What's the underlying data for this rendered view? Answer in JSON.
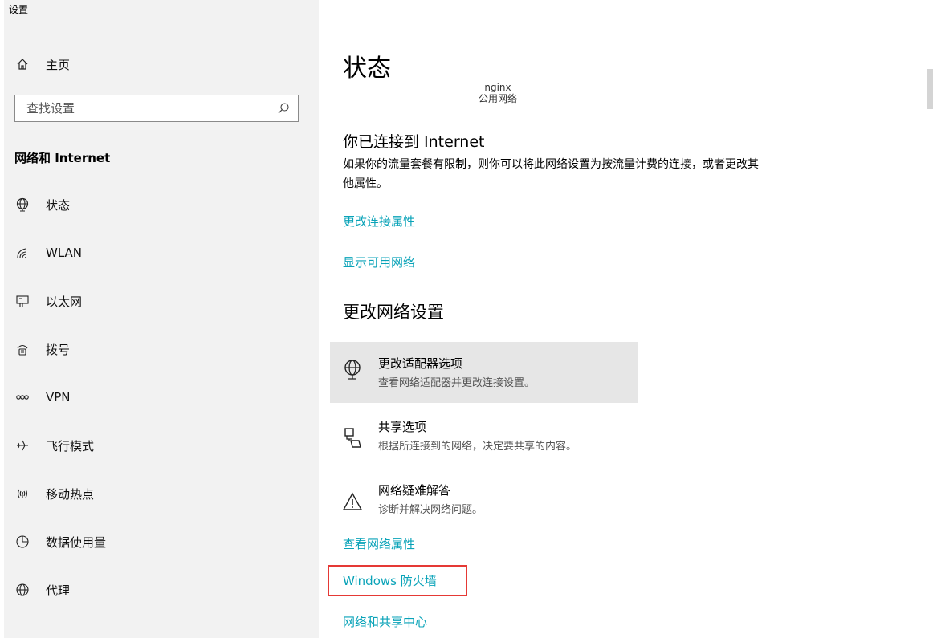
{
  "app": {
    "title": "设置"
  },
  "sidebar": {
    "home": {
      "label": "主页",
      "icon": "home-icon"
    },
    "search": {
      "placeholder": "查找设置",
      "icon": "search-icon"
    },
    "section_title": "网络和 Internet",
    "items": [
      {
        "label": "状态",
        "icon": "globe-status-icon",
        "selected": true
      },
      {
        "label": "WLAN",
        "icon": "wifi-icon"
      },
      {
        "label": "以太网",
        "icon": "ethernet-icon"
      },
      {
        "label": "拨号",
        "icon": "dialup-icon"
      },
      {
        "label": "VPN",
        "icon": "vpn-icon"
      },
      {
        "label": "飞行模式",
        "icon": "airplane-icon"
      },
      {
        "label": "移动热点",
        "icon": "hotspot-icon"
      },
      {
        "label": "数据使用量",
        "icon": "data-usage-icon"
      },
      {
        "label": "代理",
        "icon": "globe-icon"
      }
    ]
  },
  "main": {
    "title": "状态",
    "network_name": "nginx",
    "network_type": "公用网络",
    "connected_heading": "你已连接到 Internet",
    "connected_desc": "如果你的流量套餐有限制，则你可以将此网络设置为按流量计费的连接，或者更改其他属性。",
    "links": {
      "change_props": "更改连接属性",
      "show_networks": "显示可用网络"
    },
    "change_settings_heading": "更改网络设置",
    "options": [
      {
        "title": "更改适配器选项",
        "subtitle": "查看网络适配器并更改连接设置。",
        "icon": "adapter-globe-icon"
      },
      {
        "title": "共享选项",
        "subtitle": "根据所连接到的网络，决定要共享的内容。",
        "icon": "sharing-icon"
      },
      {
        "title": "网络疑难解答",
        "subtitle": "诊断并解决网络问题。",
        "icon": "warning-icon"
      }
    ],
    "bottom_links": {
      "view_props": "查看网络属性",
      "firewall": "Windows 防火墙",
      "sharing_center": "网络和共享中心"
    }
  },
  "colors": {
    "link": "#0aa3b8",
    "sidebar_bg": "#f2f2f2",
    "option_hover_bg": "#e6e6e6",
    "highlight_border": "#e53935"
  }
}
